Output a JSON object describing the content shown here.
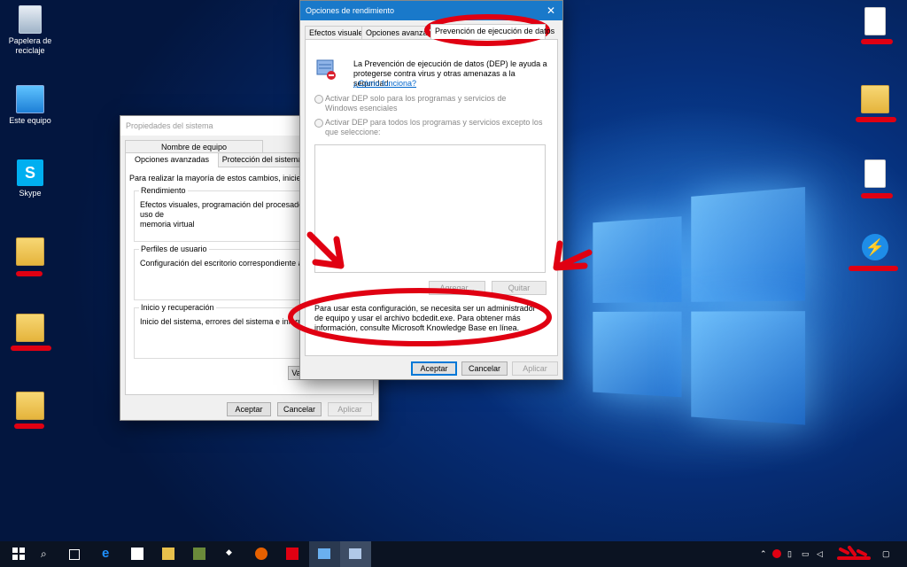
{
  "desktop": {
    "icons": [
      {
        "label": "Papelera de\nreciclaje",
        "icon": "recycle-bin-icon"
      },
      {
        "label": "Este equipo",
        "icon": "computer-icon"
      },
      {
        "label": "Skype",
        "icon": "skype-icon"
      }
    ]
  },
  "system_properties": {
    "title": "Propiedades del sistema",
    "tabs": [
      "Nombre de equipo",
      "Opciones avanzadas",
      "Protección del sistema"
    ],
    "intro": "Para realizar la mayoría de estos cambios, inicie sesión",
    "groups": [
      {
        "label": "Rendimiento",
        "text": "Efectos visuales, programación del procesador, uso de\nmemoria virtual"
      },
      {
        "label": "Perfiles de usuario",
        "text": "Configuración del escritorio correspondiente al inicio de"
      },
      {
        "label": "Inicio y recuperación",
        "text": "Inicio del sistema, errores del sistema e información"
      }
    ],
    "var_button": "Var",
    "buttons": {
      "ok": "Aceptar",
      "cancel": "Cancelar",
      "apply": "Aplicar"
    }
  },
  "perf_options": {
    "title": "Opciones de rendimiento",
    "tabs": [
      "Efectos visuales",
      "Opciones avanzadas",
      "Prevención de ejecución de datos"
    ],
    "description": "La Prevención de ejecución de datos (DEP) le ayuda a protegerse contra virus y otras amenazas a la seguridad.",
    "link": "¿Cómo funciona?",
    "radio1": "Activar DEP solo para los programas y servicios de Windows esenciales",
    "radio2": "Activar DEP para todos los programas y servicios excepto los que seleccione:",
    "add_button": "Agregar...",
    "remove_button": "Quitar",
    "note": "Para usar esta configuración, se necesita ser un administrador de equipo y usar el archivo bcdedit.exe. Para obtener más información, consulte Microsoft Knowledge Base en línea.",
    "buttons": {
      "ok": "Aceptar",
      "cancel": "Cancelar",
      "apply": "Aplicar"
    }
  },
  "colors": {
    "annotation_red": "#e00012",
    "title_active": "#1979ca"
  }
}
